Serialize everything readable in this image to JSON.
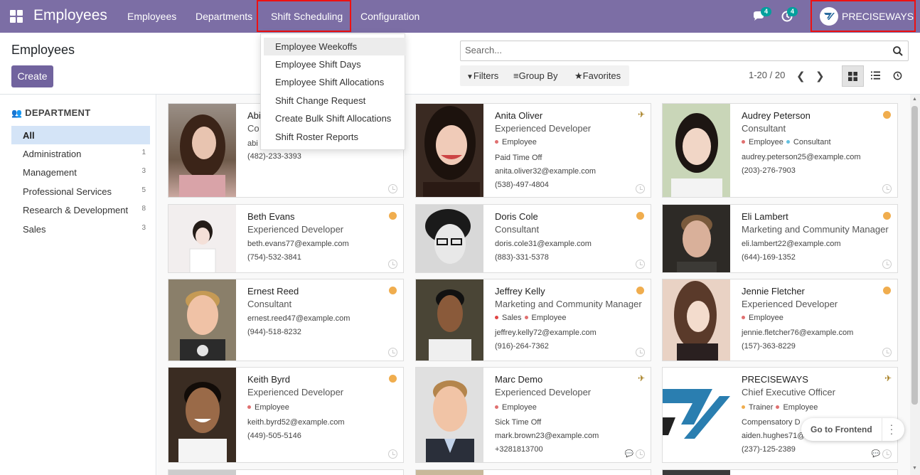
{
  "topbar": {
    "app_title": "Employees",
    "menu": [
      "Employees",
      "Departments",
      "Shift Scheduling",
      "Configuration"
    ],
    "messages_count": "4",
    "activities_count": "4",
    "company": "PRECISEWAYS",
    "highlight_color": "#ee1111",
    "brand_color": "#7c6ea5"
  },
  "control": {
    "title": "Employees",
    "create_label": "Create",
    "search_placeholder": "Search...",
    "filters_label": "Filters",
    "groupby_label": "Group By",
    "favorites_label": "Favorites",
    "pager": "1-20 / 20"
  },
  "dropdown": {
    "items": [
      "Employee Weekoffs",
      "Employee Shift Days",
      "Employee Shift Allocations",
      "Shift Change Request",
      "Create Bulk Shift Allocations",
      "Shift Roster Reports"
    ]
  },
  "sidebar": {
    "heading": "DEPARTMENT",
    "items": [
      {
        "label": "All",
        "count": ""
      },
      {
        "label": "Administration",
        "count": "1"
      },
      {
        "label": "Management",
        "count": "3"
      },
      {
        "label": "Professional Services",
        "count": "5"
      },
      {
        "label": "Research & Development",
        "count": "8"
      },
      {
        "label": "Sales",
        "count": "3"
      }
    ]
  },
  "cards": [
    {
      "name": "Abi",
      "job": "Co",
      "email": "abi",
      "phone": "(482)-233-3393"
    },
    {
      "name": "Anita Oliver",
      "job": "Experienced Developer",
      "tag1": "Employee",
      "note": "Paid Time Off",
      "email": "anita.oliver32@example.com",
      "phone": "(538)-497-4804"
    },
    {
      "name": "Audrey Peterson",
      "job": "Consultant",
      "tag1": "Employee",
      "tag2": "Consultant",
      "email": "audrey.peterson25@example.com",
      "phone": "(203)-276-7903"
    },
    {
      "name": "Beth Evans",
      "job": "Experienced Developer",
      "email": "beth.evans77@example.com",
      "phone": "(754)-532-3841"
    },
    {
      "name": "Doris Cole",
      "job": "Consultant",
      "email": "doris.cole31@example.com",
      "phone": "(883)-331-5378"
    },
    {
      "name": "Eli Lambert",
      "job": "Marketing and Community Manager",
      "email": "eli.lambert22@example.com",
      "phone": "(644)-169-1352"
    },
    {
      "name": "Ernest Reed",
      "job": "Consultant",
      "email": "ernest.reed47@example.com",
      "phone": "(944)-518-8232"
    },
    {
      "name": "Jeffrey Kelly",
      "job": "Marketing and Community Manager",
      "tag1": "Sales",
      "tag2": "Employee",
      "email": "jeffrey.kelly72@example.com",
      "phone": "(916)-264-7362"
    },
    {
      "name": "Jennie Fletcher",
      "job": "Experienced Developer",
      "tag1": "Employee",
      "email": "jennie.fletcher76@example.com",
      "phone": "(157)-363-8229"
    },
    {
      "name": "Keith Byrd",
      "job": "Experienced Developer",
      "tag1": "Employee",
      "email": "keith.byrd52@example.com",
      "phone": "(449)-505-5146"
    },
    {
      "name": "Marc Demo",
      "job": "Experienced Developer",
      "tag1": "Employee",
      "note": "Sick Time Off",
      "email": "mark.brown23@example.com",
      "phone": "+3281813700"
    },
    {
      "name": "PRECISEWAYS",
      "job": "Chief Executive Officer",
      "tag1": "Trainer",
      "tag2": "Employee",
      "note": "Compensatory D",
      "email": "aiden.hughes71@",
      "phone": "(237)-125-2389"
    }
  ],
  "frontend_button": "Go to Frontend"
}
